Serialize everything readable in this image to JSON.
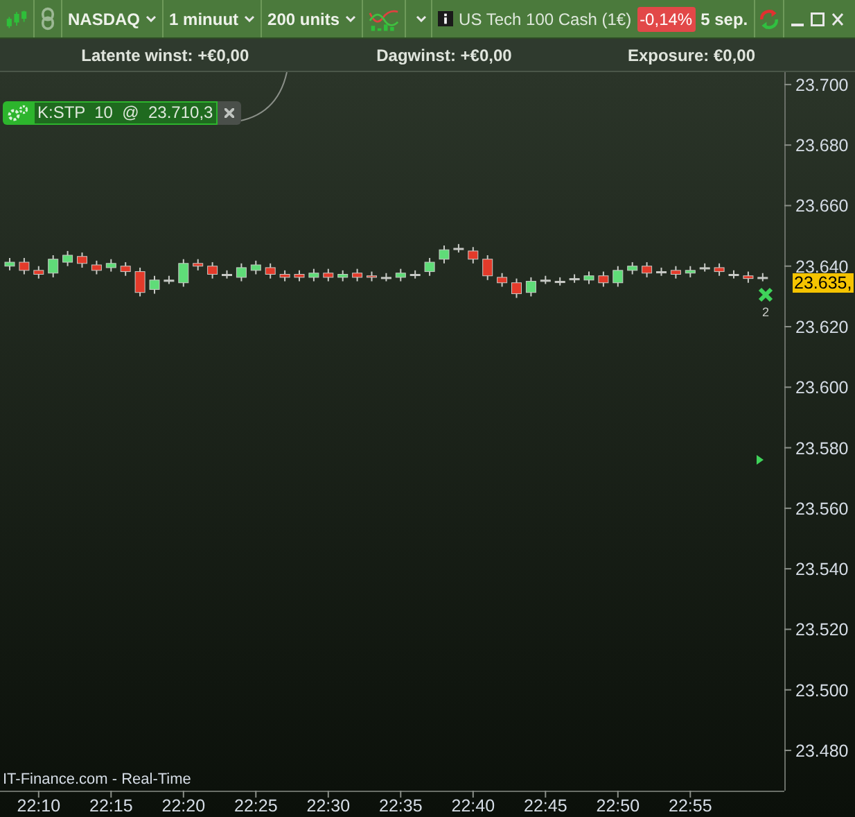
{
  "toolbar": {
    "market": "NASDAQ",
    "interval": "1 minuut",
    "units": "200 units",
    "instrument": "US Tech 100 Cash (1€)",
    "change": "-0,14%",
    "date": "5 sep."
  },
  "summary": [
    {
      "label": "Latente winst: +€0,00"
    },
    {
      "label": "Dagwinst: +€0,00"
    },
    {
      "label": "Exposure: €0,00"
    }
  ],
  "order": {
    "label": "K:STP  10  @  23.710,3"
  },
  "chart_data": {
    "type": "candlestick",
    "categories": [
      null,
      null,
      "22:10",
      null,
      null,
      null,
      null,
      "22:15",
      null,
      null,
      null,
      null,
      "22:20",
      null,
      null,
      null,
      null,
      "22:25",
      null,
      null,
      null,
      null,
      "22:30",
      null,
      null,
      null,
      null,
      "22:35",
      null,
      null,
      null,
      null,
      "22:40",
      null,
      null,
      null,
      null,
      "22:45",
      null,
      null,
      null,
      null,
      "22:50",
      null,
      null,
      null,
      null,
      "22:55",
      null,
      null,
      null,
      null,
      null
    ],
    "ylim": [
      23466.7,
      23704.1
    ],
    "ohlc": [
      [
        23640.0,
        23642.7,
        23638.6,
        23641.3
      ],
      [
        23641.3,
        23642.7,
        23637.3,
        23638.6
      ],
      [
        23638.6,
        23640.0,
        23635.9,
        23637.3
      ],
      [
        23637.7,
        23643.6,
        23636.3,
        23642.3
      ],
      [
        23641.3,
        23645.0,
        23640.0,
        23643.6
      ],
      [
        23643.2,
        23644.5,
        23639.5,
        23640.9
      ],
      [
        23640.4,
        23641.8,
        23637.3,
        23638.6
      ],
      [
        23639.5,
        23642.3,
        23638.2,
        23640.9
      ],
      [
        23640.0,
        23641.3,
        23636.8,
        23638.2
      ],
      [
        23638.2,
        23639.5,
        23630.0,
        23631.3
      ],
      [
        23632.3,
        23636.8,
        23630.9,
        23635.4
      ],
      [
        23635.4,
        23636.8,
        23634.1,
        23635.4
      ],
      [
        23634.5,
        23642.3,
        23633.2,
        23640.9
      ],
      [
        23640.9,
        23642.3,
        23638.6,
        23640.0
      ],
      [
        23640.0,
        23641.3,
        23635.9,
        23637.3
      ],
      [
        23637.3,
        23638.6,
        23635.9,
        23637.3
      ],
      [
        23636.3,
        23640.9,
        23635.0,
        23639.5
      ],
      [
        23638.6,
        23641.8,
        23637.3,
        23640.4
      ],
      [
        23639.5,
        23640.9,
        23635.9,
        23637.3
      ],
      [
        23637.3,
        23638.6,
        23635.0,
        23636.3
      ],
      [
        23637.3,
        23638.6,
        23635.0,
        23636.3
      ],
      [
        23636.3,
        23639.1,
        23635.0,
        23637.7
      ],
      [
        23637.7,
        23639.1,
        23635.0,
        23636.3
      ],
      [
        23636.3,
        23638.6,
        23635.0,
        23637.3
      ],
      [
        23637.7,
        23639.1,
        23635.0,
        23636.3
      ],
      [
        23636.8,
        23638.2,
        23635.0,
        23636.3
      ],
      [
        23636.3,
        23637.7,
        23635.0,
        23636.3
      ],
      [
        23636.3,
        23639.1,
        23635.0,
        23637.7
      ],
      [
        23637.3,
        23638.6,
        23635.9,
        23637.3
      ],
      [
        23638.2,
        23642.7,
        23636.8,
        23641.3
      ],
      [
        23642.3,
        23646.8,
        23640.9,
        23645.4
      ],
      [
        23645.9,
        23647.3,
        23644.5,
        23645.9
      ],
      [
        23645.0,
        23646.3,
        23640.9,
        23642.3
      ],
      [
        23642.3,
        23643.6,
        23635.4,
        23636.8
      ],
      [
        23636.3,
        23637.7,
        23633.2,
        23634.5
      ],
      [
        23634.5,
        23635.9,
        23629.5,
        23630.9
      ],
      [
        23631.3,
        23636.3,
        23630.0,
        23635.0
      ],
      [
        23635.4,
        23636.8,
        23634.1,
        23635.4
      ],
      [
        23635.0,
        23636.3,
        23633.6,
        23635.0
      ],
      [
        23635.9,
        23637.3,
        23634.5,
        23635.9
      ],
      [
        23635.4,
        23638.2,
        23634.1,
        23636.8
      ],
      [
        23636.8,
        23638.2,
        23633.2,
        23634.5
      ],
      [
        23634.5,
        23640.0,
        23633.2,
        23638.6
      ],
      [
        23638.6,
        23641.3,
        23637.3,
        23640.0
      ],
      [
        23640.0,
        23641.3,
        23636.3,
        23637.7
      ],
      [
        23638.2,
        23639.5,
        23636.8,
        23638.2
      ],
      [
        23638.6,
        23640.0,
        23635.9,
        23637.3
      ],
      [
        23637.7,
        23640.0,
        23636.3,
        23638.6
      ],
      [
        23639.5,
        23640.9,
        23638.2,
        23639.5
      ],
      [
        23639.5,
        23640.9,
        23636.8,
        23638.2
      ],
      [
        23637.3,
        23638.6,
        23635.9,
        23637.3
      ],
      [
        23636.8,
        23638.2,
        23634.5,
        23635.9
      ],
      [
        23636.3,
        23637.7,
        23635.0,
        23636.3
      ]
    ],
    "yticks": [
      {
        "value": 23700,
        "label": "23.700"
      },
      {
        "value": 23680,
        "label": "23.680"
      },
      {
        "value": 23660,
        "label": "23.660"
      },
      {
        "value": 23640,
        "label": "23.640"
      },
      {
        "value": 23620,
        "label": "23.620"
      },
      {
        "value": 23600,
        "label": "23.600"
      },
      {
        "value": 23580,
        "label": "23.580"
      },
      {
        "value": 23560,
        "label": "23.560"
      },
      {
        "value": 23540,
        "label": "23.540"
      },
      {
        "value": 23520,
        "label": "23.520"
      },
      {
        "value": 23500,
        "label": "23.500"
      },
      {
        "value": 23480,
        "label": "23.480"
      }
    ]
  },
  "current_price": "23.635,",
  "marker_count": "2",
  "source": "IT-Finance.com - Real-Time"
}
